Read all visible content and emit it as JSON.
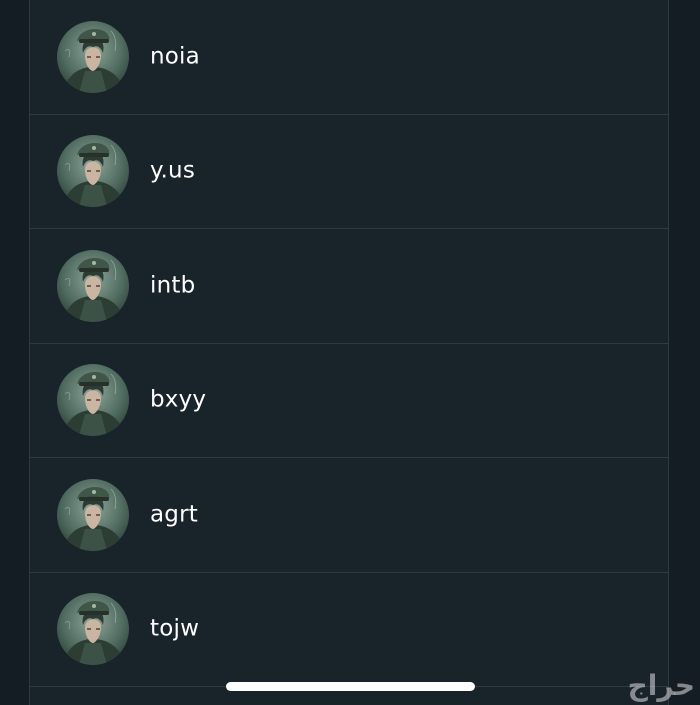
{
  "accounts": [
    {
      "username": "noia",
      "avatar_icon": "character-avatar-icon"
    },
    {
      "username": "y.us",
      "avatar_icon": "character-avatar-icon"
    },
    {
      "username": "intb",
      "avatar_icon": "character-avatar-icon"
    },
    {
      "username": "bxyy",
      "avatar_icon": "character-avatar-icon"
    },
    {
      "username": "agrt",
      "avatar_icon": "character-avatar-icon"
    },
    {
      "username": "tojw",
      "avatar_icon": "character-avatar-icon"
    }
  ],
  "watermark": {
    "text": "حراج"
  },
  "colors": {
    "background": "#141d23",
    "list_background": "#19232a",
    "divider": "#2e3a43",
    "text": "#ffffff"
  }
}
